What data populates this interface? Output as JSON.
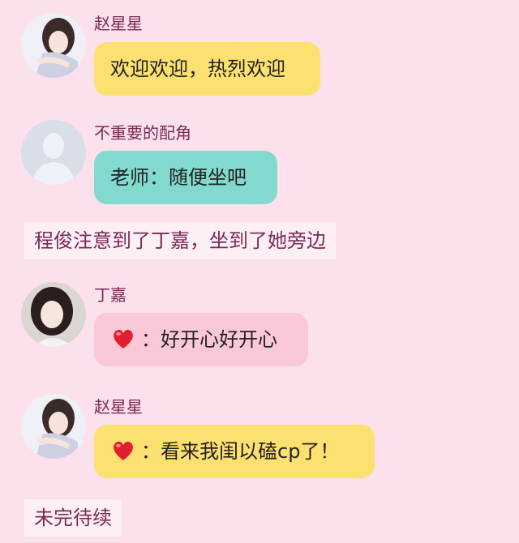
{
  "colors": {
    "background": "#fce1ec",
    "name_text": "#7a2a55",
    "bubble_yellow": "#fde170",
    "bubble_teal": "#82d9cd",
    "bubble_pink": "#fac8d6",
    "narration_bg": "#fdf0f5"
  },
  "messages": [
    {
      "name": "赵星星",
      "text": "欢迎欢迎，热烈欢迎",
      "avatar": "girl-photo-avatar"
    },
    {
      "name": "不重要的配角",
      "text": "老师：随便坐吧",
      "avatar": "default-person-avatar"
    }
  ],
  "narration_1": "程俊注意到了丁嘉，坐到了她旁边",
  "message_3": {
    "name": "丁嘉",
    "emoji": "heart-emoji",
    "text": "：好开心好开心",
    "avatar": "girl-photo-avatar"
  },
  "message_4": {
    "name": "赵星星",
    "emoji": "heart-emoji",
    "text": "：看来我闺以磕cp了！",
    "avatar": "girl-photo-avatar"
  },
  "narration_2": "未完待续"
}
